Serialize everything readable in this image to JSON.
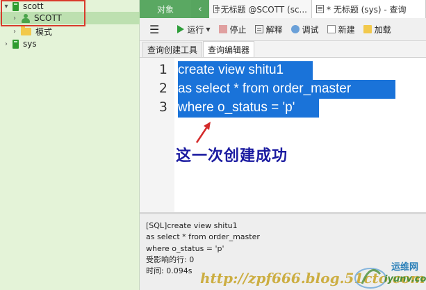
{
  "tree": {
    "items": [
      {
        "label": "scott",
        "type": "connection",
        "expanded": true
      },
      {
        "label": "SCOTT",
        "type": "user",
        "expanded": false,
        "selected": true
      },
      {
        "label": "模式",
        "type": "folder",
        "expanded": false
      },
      {
        "label": "sys",
        "type": "connection",
        "expanded": false
      }
    ]
  },
  "tabs": {
    "objects_label": "对象",
    "nav_icon": "chevron-left-icon",
    "items": [
      {
        "label": "无标题 @SCOTT (sc..."
      },
      {
        "label": "* 无标题 (sys) - 查询"
      }
    ]
  },
  "toolbar": {
    "run_label": "运行",
    "stop_label": "停止",
    "explain_label": "解释",
    "debug_label": "调试",
    "new_label": "新建",
    "load_label": "加载"
  },
  "subtabs": {
    "builder_label": "查询创建工具",
    "editor_label": "查询编辑器"
  },
  "editor": {
    "lines": [
      {
        "no": "1",
        "text": "create view shitu1 "
      },
      {
        "no": "2",
        "text": "as select * from order_master "
      },
      {
        "no": "3",
        "text": "where o_status = 'p'"
      }
    ],
    "annotation": "这一次创建成功"
  },
  "output": {
    "lines": [
      "[SQL]create view shitu1",
      "as select * from order_master",
      "where o_status = 'p'",
      "受影响的行: 0",
      "时间: 0.094s"
    ]
  },
  "watermark": {
    "url": "http://zpf666.blog.51cto.com",
    "site_cn": "运维网",
    "site_en": "iyunv.com"
  },
  "colors": {
    "tree_bg": "#e4f3d8",
    "tabstrip": "#4a9a52",
    "selection": "#1a73d9",
    "annotation": "#1a1aa0",
    "highlight_box": "#d93a2b"
  }
}
